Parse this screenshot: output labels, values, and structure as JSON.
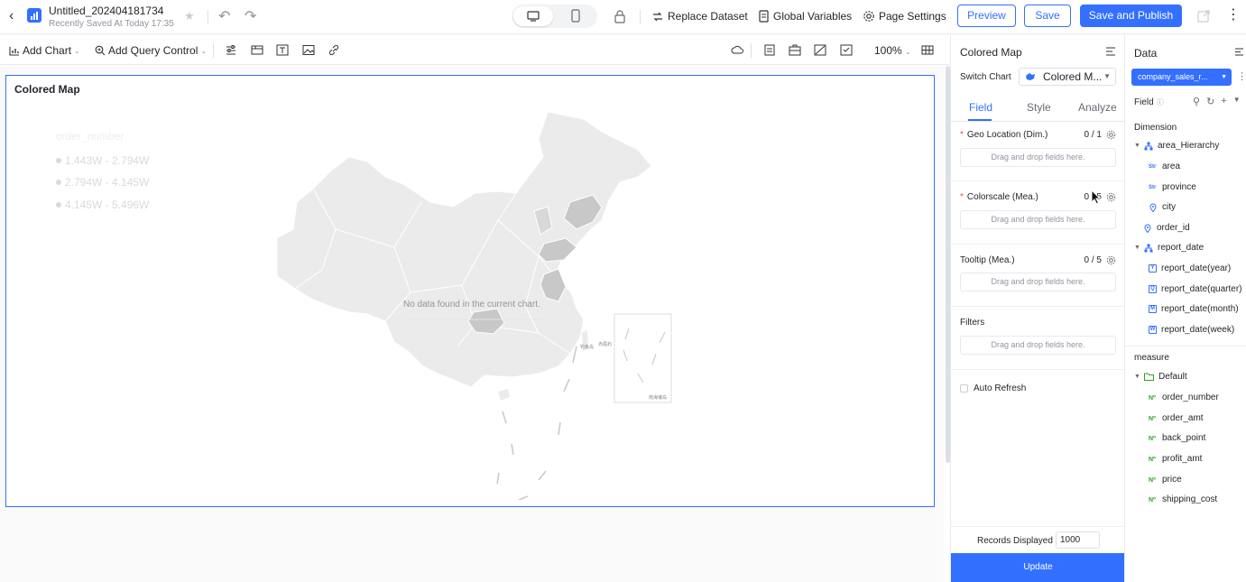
{
  "header": {
    "doc_title": "Untitled_202404181734",
    "saved_status": "Recently Saved At Today 17:35",
    "actions": {
      "replace_dataset": "Replace Dataset",
      "global_variables": "Global Variables",
      "page_settings": "Page Settings"
    },
    "buttons": {
      "preview": "Preview",
      "save": "Save",
      "save_publish": "Save and Publish"
    }
  },
  "toolbar": {
    "add_chart": "Add Chart",
    "add_query_control": "Add Query Control",
    "zoom": "100%"
  },
  "chart": {
    "title": "Colored Map",
    "legend_title": "order_number",
    "legend_items": [
      "1.443W - 2.794W",
      "2.794W - 4.145W",
      "4.145W - 5.496W"
    ],
    "no_data": "No data found in the current chart.",
    "map_labels": {
      "south_sea": "南海诸岛",
      "island_a": "钓鱼岛",
      "island_b": "赤尾屿"
    }
  },
  "config": {
    "title": "Colored Map",
    "switch_chart_label": "Switch Chart",
    "switch_chart_value": "Colored M...",
    "tabs": [
      "Field",
      "Style",
      "Analyze"
    ],
    "slots": [
      {
        "label": "Geo Location (Dim.)",
        "count": "0 / 1",
        "required": true,
        "placeholder": "Drag and drop fields here."
      },
      {
        "label": "Colorscale (Mea.)",
        "count": "0 / 5",
        "required": true,
        "placeholder": "Drag and drop fields here."
      },
      {
        "label": "Tooltip (Mea.)",
        "count": "0 / 5",
        "required": false,
        "placeholder": "Drag and drop fields here."
      },
      {
        "label": "Filters",
        "count": "",
        "required": false,
        "placeholder": "Drag and drop fields here."
      }
    ],
    "auto_refresh": "Auto Refresh",
    "records_label": "Records Displayed",
    "records_value": "1000",
    "update_button": "Update"
  },
  "data_panel": {
    "title": "Data",
    "dataset": "company_sales_r...",
    "field_label": "Field",
    "dimension_label": "Dimension",
    "measure_label": "measure",
    "dimension_tree": {
      "area_hierarchy": "area_Hierarchy",
      "area": "area",
      "province": "province",
      "city": "city",
      "order_id": "order_id",
      "report_date": "report_date",
      "report_year": "report_date(year)",
      "report_quarter": "report_date(quarter)",
      "report_month": "report_date(month)",
      "report_week": "report_date(week)"
    },
    "measure_folder": "Default",
    "measures": [
      "order_number",
      "order_amt",
      "back_point",
      "profit_amt",
      "price",
      "shipping_cost"
    ]
  },
  "colors": {
    "accent": "#3370ff",
    "map_fill": "#ebebeb",
    "map_dark": "#c8c8c8",
    "map_mid": "#d4d4d4"
  }
}
